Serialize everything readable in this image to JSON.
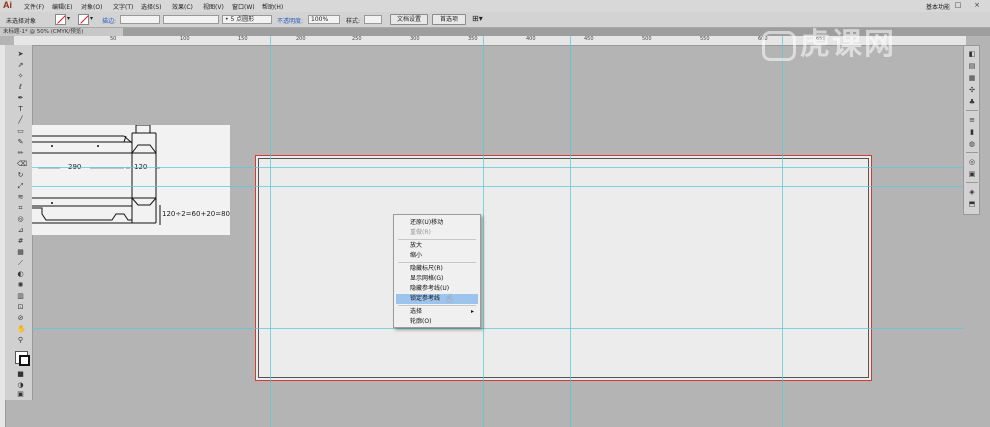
{
  "app": {
    "logo": "Ai",
    "workspace": "基本功能"
  },
  "menubar": {
    "items": [
      "文件(F)",
      "编辑(E)",
      "对象(O)",
      "文字(T)",
      "选择(S)",
      "效果(C)",
      "视图(V)",
      "窗口(W)",
      "帮助(H)"
    ]
  },
  "controlbar": {
    "selection_status": "未选择对象",
    "stroke_label": "描边:",
    "brush_value": "5 点圆形",
    "opacity_label": "不透明度:",
    "opacity_value": "100%",
    "style_label": "样式:",
    "doc_setup_button": "文档设置",
    "preferences_button": "首选项"
  },
  "document_tab": {
    "title": "未标题-1* @ 50% (CMYK/预览)"
  },
  "rulers": {
    "h_labels": [
      "50",
      "100",
      "150",
      "200",
      "250",
      "300",
      "350",
      "400",
      "450",
      "500",
      "550",
      "600",
      "650"
    ],
    "v_labels": [
      "50",
      "100",
      "150",
      "200",
      "250"
    ]
  },
  "artwork": {
    "dim_290": "290",
    "dim_120": "120",
    "formula": "120÷2=60+20=80"
  },
  "context_menu": {
    "items": [
      {
        "label": "还原(U)移动",
        "disabled": false
      },
      {
        "label": "重做(R)",
        "disabled": true
      },
      {
        "label": "放大",
        "disabled": false
      },
      {
        "label": "缩小",
        "disabled": false
      },
      {
        "label": "隐藏标尺(R)",
        "disabled": false
      },
      {
        "label": "显示网格(G)",
        "disabled": false
      },
      {
        "label": "隐藏参考线(U)",
        "disabled": false
      },
      {
        "label": "锁定参考线",
        "disabled": false,
        "highlighted": true
      },
      {
        "label": "选择",
        "disabled": false,
        "submenu": true
      },
      {
        "label": "轮廓(O)",
        "disabled": false
      }
    ]
  },
  "watermark": {
    "text": "虎课网"
  },
  "colors": {
    "artboard_border": "#d23a3a",
    "guide": "#57cbd6",
    "menu_highlight": "#9cc4ec",
    "link_blue": "#2b5fbf"
  }
}
